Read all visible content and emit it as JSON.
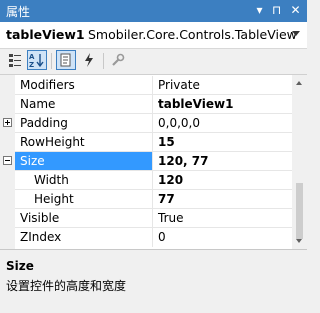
{
  "window": {
    "title": "属性",
    "buttons": {
      "dropdown": "▾",
      "pin": "⊓",
      "close": "✕"
    }
  },
  "object_selector": {
    "name": "tableView1",
    "type": "Smobiler.Core.Controls.TableView"
  },
  "toolbar": {
    "buttons": [
      "categorized-icon",
      "alphabetical-icon",
      "properties-icon",
      "events-icon",
      "wrench-icon"
    ]
  },
  "properties": [
    {
      "name": "Modifiers",
      "value": "Private",
      "bold": false
    },
    {
      "name": "Name",
      "value": "tableView1",
      "bold": true
    },
    {
      "name": "Padding",
      "value": "0,0,0,0",
      "bold": false,
      "expander": "+"
    },
    {
      "name": "RowHeight",
      "value": "15",
      "bold": true
    },
    {
      "name": "Size",
      "value": "120, 77",
      "bold": true,
      "expander": "-",
      "selected": true
    },
    {
      "name": "Width",
      "value": "120",
      "bold": true,
      "child": true
    },
    {
      "name": "Height",
      "value": "77",
      "bold": true,
      "child": true
    },
    {
      "name": "Visible",
      "value": "True",
      "bold": false
    },
    {
      "name": "ZIndex",
      "value": "0",
      "bold": false
    }
  ],
  "description": {
    "title": "Size",
    "text": "设置控件的高度和宽度"
  },
  "colors": {
    "title_bar": "#3c7fc1",
    "selection": "#3399ff",
    "background": "#f0f0f0"
  }
}
